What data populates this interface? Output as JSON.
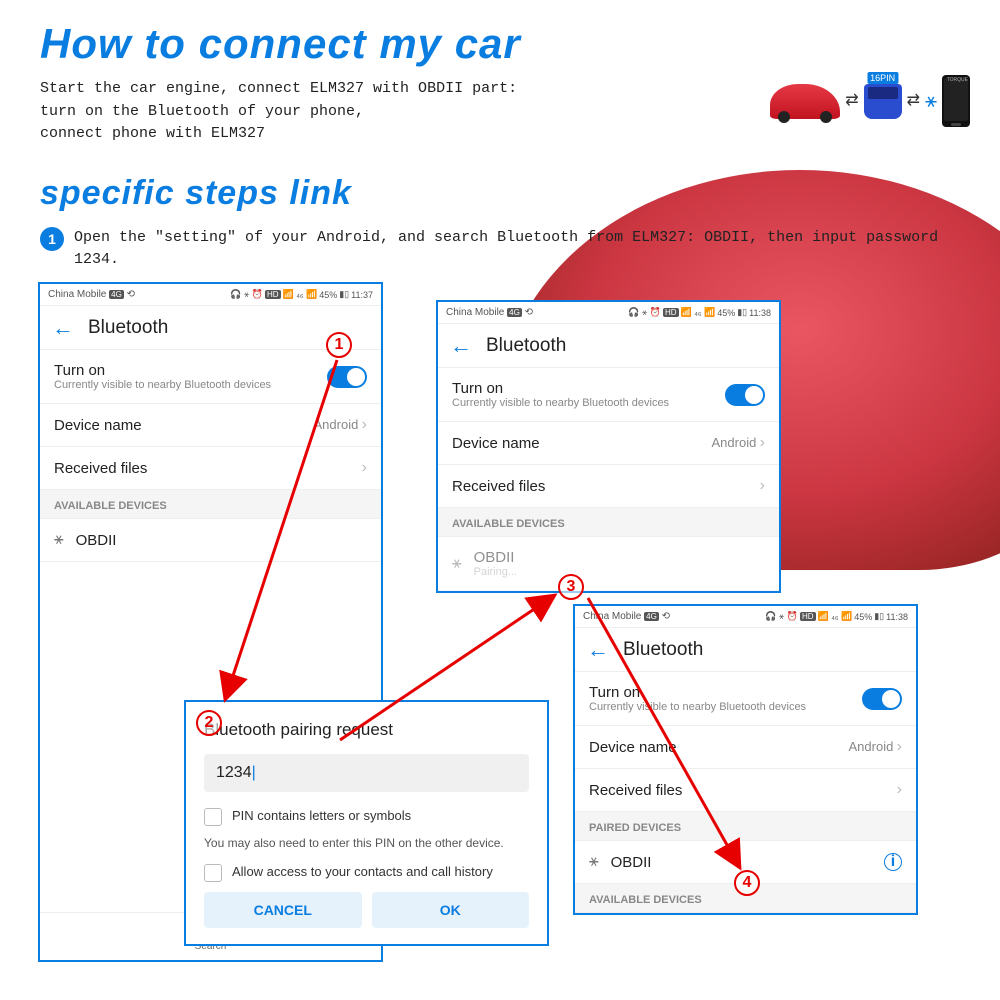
{
  "title1": "How to connect my car",
  "intro_line1": "Start the car engine, connect ELM327 with OBDII part:",
  "intro_line2": "turn on the Bluetooth of your phone,",
  "intro_line3": "connect phone with ELM327",
  "pin_label": "16PIN",
  "torque_label": "TORQUE",
  "title2": "specific steps link",
  "step_num": "1",
  "step_text": "Open the \"setting\" of your Android, and search Bluetooth from ELM327: OBDII, then input password 1234.",
  "status": {
    "carrier": "China Mobile",
    "battery": "45%",
    "time1": "11:37",
    "time2": "11:38",
    "hd": "HD"
  },
  "bt": {
    "header": "Bluetooth",
    "turn_on": "Turn on",
    "visible": "Currently visible to nearby Bluetooth devices",
    "device_name_label": "Device name",
    "device_name_value": "Android",
    "received_files": "Received files",
    "available": "AVAILABLE DEVICES",
    "paired": "PAIRED DEVICES",
    "obdii": "OBDII",
    "pairing": "Pairing..."
  },
  "dialog": {
    "title": "Bluetooth pairing request",
    "pin": "1234",
    "cb1": "PIN contains letters or symbols",
    "note": "You may also need to enter this PIN on the other device.",
    "cb2": "Allow access to your contacts and call history",
    "cancel": "CANCEL",
    "ok": "OK"
  },
  "nav": {
    "search": "Search"
  },
  "callouts": {
    "c1": "1",
    "c2": "2",
    "c3": "3",
    "c4": "4"
  }
}
